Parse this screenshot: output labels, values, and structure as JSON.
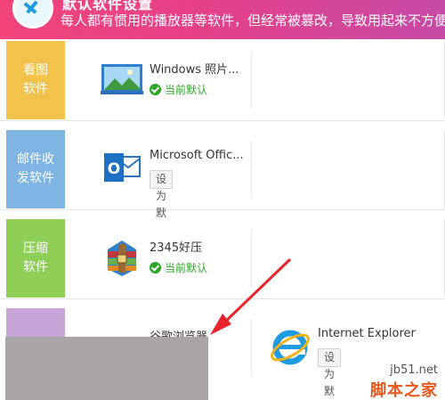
{
  "header": {
    "title": "默认软件设置",
    "description": "每人都有惯用的播放器等软件，但经常被篡改，导致用起来不方便。"
  },
  "rows": [
    {
      "category": [
        "看图",
        "软件"
      ],
      "color": "#f2c24a",
      "apps": [
        {
          "name": "Windows 照片...",
          "status": "当前默认",
          "icon": "photo-viewer-icon"
        }
      ]
    },
    {
      "category": [
        "邮件收",
        "发软件"
      ],
      "color": "#7fb5e3",
      "apps": [
        {
          "name": "Microsoft Offic...",
          "button": "设为默认",
          "icon": "outlook-icon"
        }
      ]
    },
    {
      "category": [
        "压缩",
        "软件"
      ],
      "color": "#8fcf57",
      "apps": [
        {
          "name": "2345好压",
          "status": "当前默认",
          "icon": "winrar-icon"
        }
      ]
    },
    {
      "category": [
        "",
        ""
      ],
      "color": "#c9a4d9",
      "apps": [
        {
          "name": "谷歌浏览器",
          "icon": "chrome-icon"
        },
        {
          "name": "Internet Explorer",
          "button": "设为默认",
          "icon": "internet-explorer-icon"
        }
      ]
    }
  ],
  "watermark": {
    "site": "jb51.net",
    "brand": "脚本之家"
  },
  "colors": {
    "header_start": "#f1447a",
    "header_end": "#c74aa6",
    "status_green": "#2fa52a",
    "arrow_red": "#e8232b"
  }
}
